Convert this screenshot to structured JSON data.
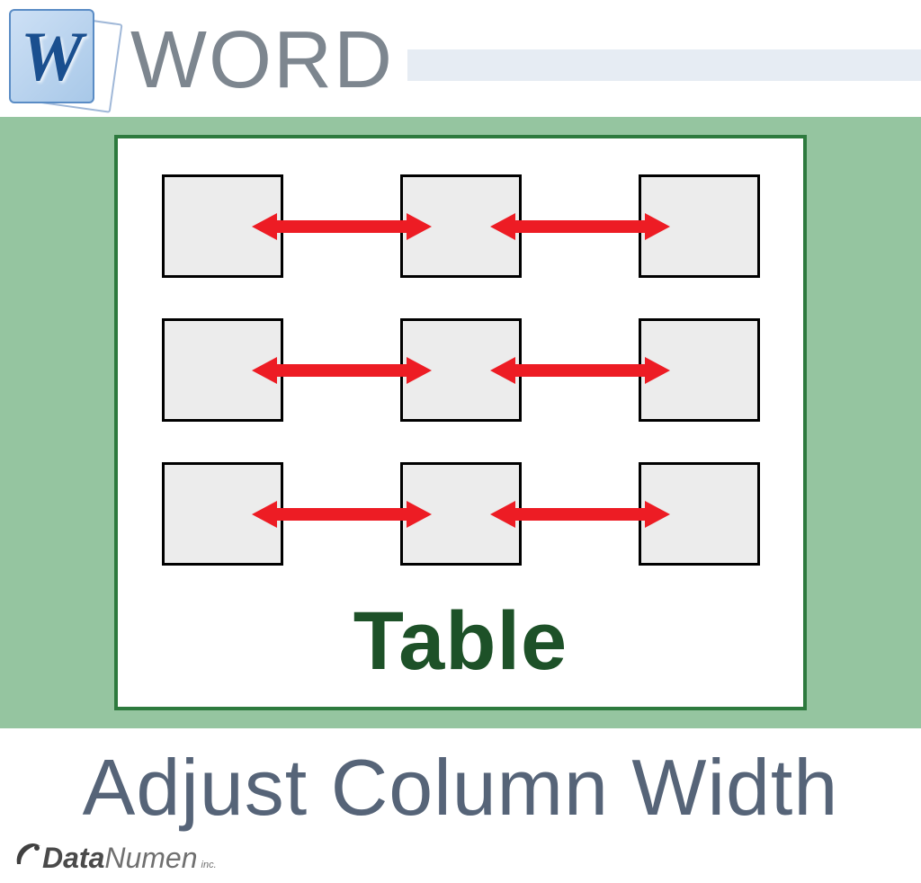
{
  "header": {
    "title": "WORD",
    "icon_letter": "W"
  },
  "diagram": {
    "label": "Table",
    "rows": 3,
    "cols": 3
  },
  "footer": {
    "title": "Adjust Column Width"
  },
  "brand": {
    "name_bold": "Data",
    "name_light": "Numen",
    "suffix": "inc."
  }
}
